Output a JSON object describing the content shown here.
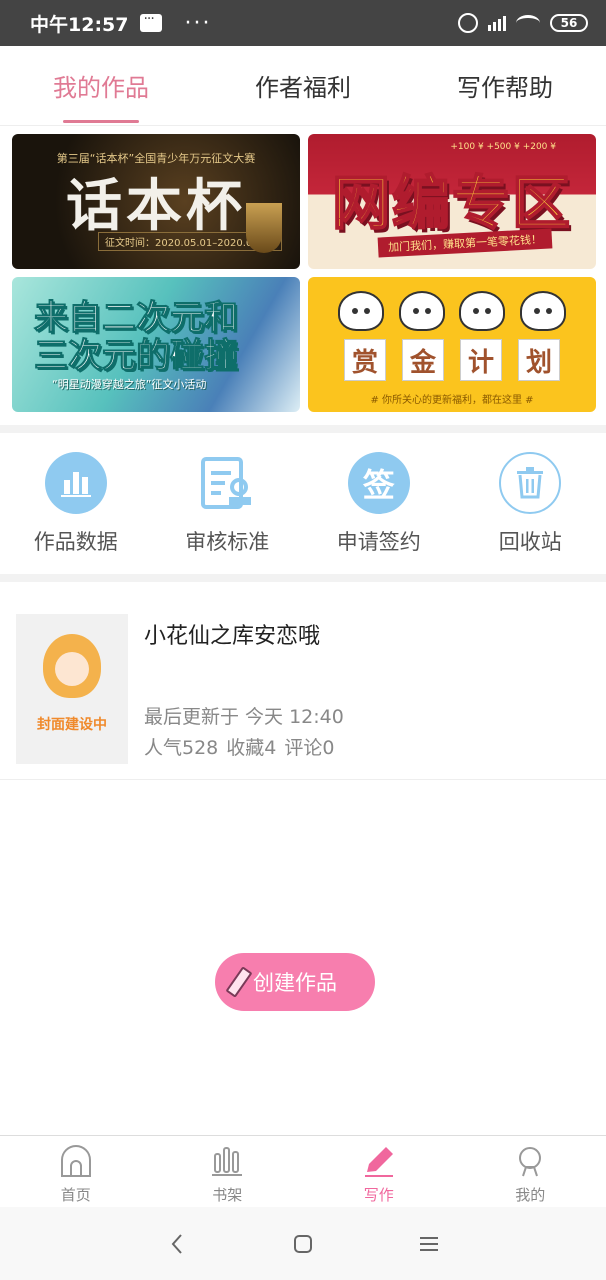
{
  "status_bar": {
    "time": "中午12:57",
    "dots": "···",
    "battery": "56"
  },
  "tabs": [
    {
      "label": "我的作品",
      "active": true
    },
    {
      "label": "作者福利",
      "active": false
    },
    {
      "label": "写作帮助",
      "active": false
    }
  ],
  "banners": {
    "banner1": {
      "title": "话本杯",
      "top_text": "第三届“话本杯”全国青少年万元征文大赛",
      "date_text": "征文时间：2020.05.01–2020.08.10"
    },
    "banner2": {
      "title": "网编专区",
      "strip_text": "加门我们，赚取第一笔零花钱！",
      "money_text": "+100 ¥  +500 ¥  +200 ¥"
    },
    "banner3": {
      "title_line1": "来自二次元和",
      "title_line2": "三次元的碰撞",
      "subtitle": "“明星动漫穿越之旅”征文小活动"
    },
    "banner4": {
      "words": [
        "赏",
        "金",
        "计",
        "划"
      ],
      "note": "# 你所关心的更新福利，都在这里 #"
    }
  },
  "quick_actions": [
    {
      "label": "作品数据",
      "icon": "bar-chart-icon"
    },
    {
      "label": "审核标准",
      "icon": "review-document-icon"
    },
    {
      "label": "申请签约",
      "icon": "sign-contract-icon"
    },
    {
      "label": "回收站",
      "icon": "trash-icon"
    }
  ],
  "work": {
    "title": "小花仙之库安恋哦",
    "cover_text": "封面建设中",
    "last_update": "最后更新于 今天 12:40",
    "popularity": "人气528",
    "favorites": "收藏4",
    "comments": "评论0"
  },
  "create_button": {
    "label": "创建作品"
  },
  "bottom_nav": [
    {
      "label": "首页",
      "icon": "home-icon",
      "active": false
    },
    {
      "label": "书架",
      "icon": "bookshelf-icon",
      "active": false
    },
    {
      "label": "写作",
      "icon": "pen-icon",
      "active": true
    },
    {
      "label": "我的",
      "icon": "profile-icon",
      "active": false
    }
  ],
  "colors": {
    "accent": "#e07a94",
    "create_button": "#f77eae",
    "active_nav": "#f0679d",
    "quick_icon": "#8fcaf0"
  }
}
